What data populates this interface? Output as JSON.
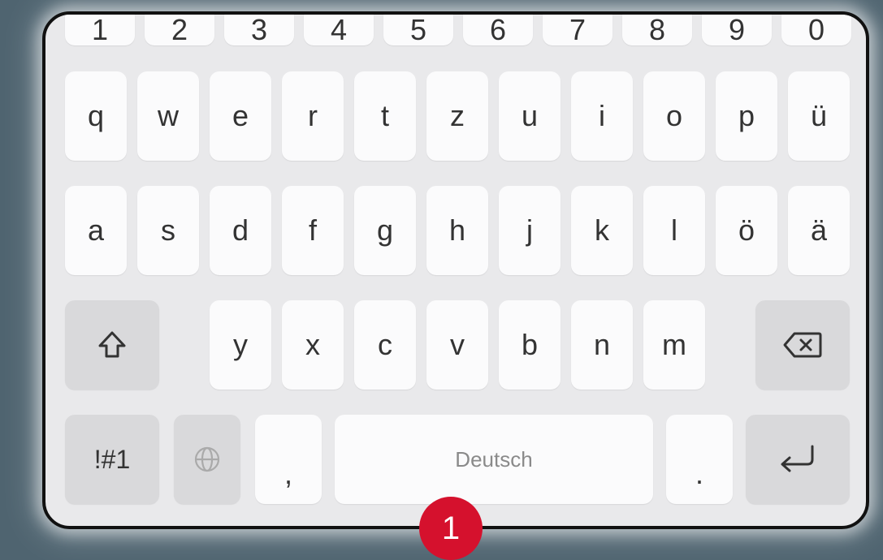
{
  "keyboard": {
    "number_row": [
      "1",
      "2",
      "3",
      "4",
      "5",
      "6",
      "7",
      "8",
      "9",
      "0"
    ],
    "row1": [
      "q",
      "w",
      "e",
      "r",
      "t",
      "z",
      "u",
      "i",
      "o",
      "p",
      "ü"
    ],
    "row2": [
      "a",
      "s",
      "d",
      "f",
      "g",
      "h",
      "j",
      "k",
      "l",
      "ö",
      "ä"
    ],
    "row3": [
      "y",
      "x",
      "c",
      "v",
      "b",
      "n",
      "m"
    ],
    "symbols_label": "!#1",
    "comma": ",",
    "space_label": "Deutsch",
    "period": "."
  },
  "annotation": {
    "badge_number": "1",
    "badge_color": "#d5112d"
  },
  "icons": {
    "shift": "shift-icon",
    "backspace": "backspace-icon",
    "globe": "globe-icon",
    "enter": "enter-icon"
  }
}
